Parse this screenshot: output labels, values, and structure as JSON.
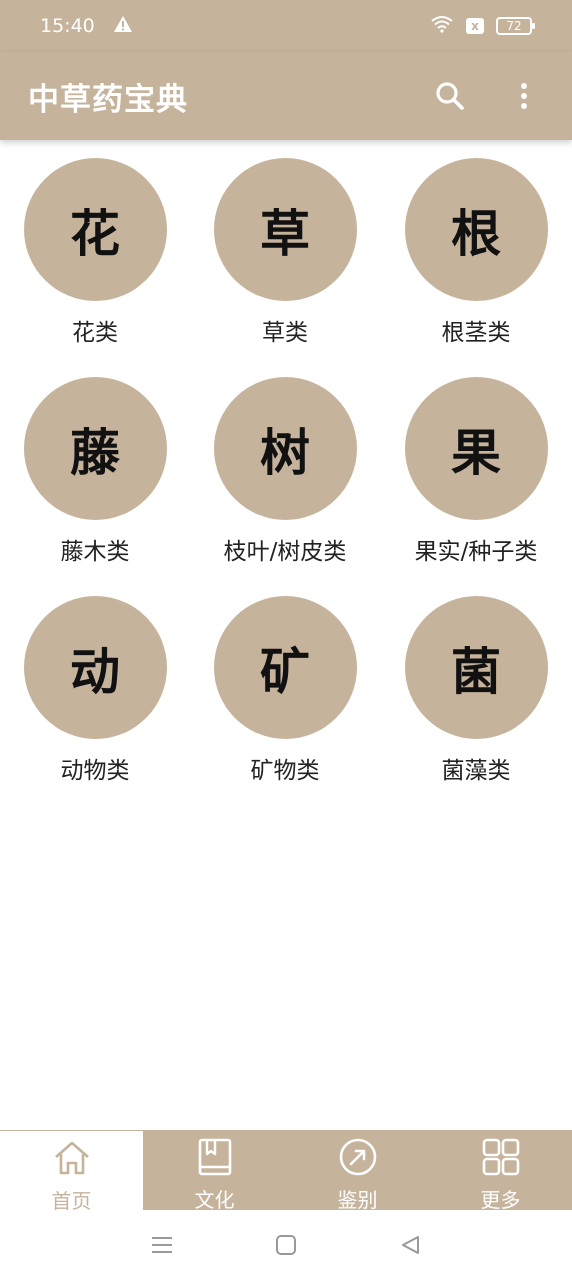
{
  "status_bar": {
    "time": "15:40",
    "battery": "72",
    "sim_label": "x",
    "icons": [
      "warning-icon",
      "wifi-icon",
      "sim-icon",
      "battery-icon"
    ]
  },
  "app_bar": {
    "title": "中草药宝典",
    "icons": [
      "search-icon",
      "more-vert-icon"
    ]
  },
  "categories": [
    {
      "glyph": "花",
      "label": "花类"
    },
    {
      "glyph": "草",
      "label": "草类"
    },
    {
      "glyph": "根",
      "label": "根茎类"
    },
    {
      "glyph": "藤",
      "label": "藤木类"
    },
    {
      "glyph": "树",
      "label": "枝叶/树皮类"
    },
    {
      "glyph": "果",
      "label": "果实/种子类"
    },
    {
      "glyph": "动",
      "label": "动物类"
    },
    {
      "glyph": "矿",
      "label": "矿物类"
    },
    {
      "glyph": "菌",
      "label": "菌藻类"
    }
  ],
  "bottom_nav": [
    {
      "label": "首页",
      "icon": "home-icon",
      "active": true
    },
    {
      "label": "文化",
      "icon": "book-icon",
      "active": false
    },
    {
      "label": "鉴别",
      "icon": "compass-icon",
      "active": false
    },
    {
      "label": "更多",
      "icon": "grid-icon",
      "active": false
    }
  ],
  "system_nav": {
    "icons": [
      "menu-icon",
      "home-square-icon",
      "back-icon"
    ]
  },
  "colors": {
    "accent": "#c6b39c",
    "text": "#222222",
    "background": "#ffffff"
  }
}
